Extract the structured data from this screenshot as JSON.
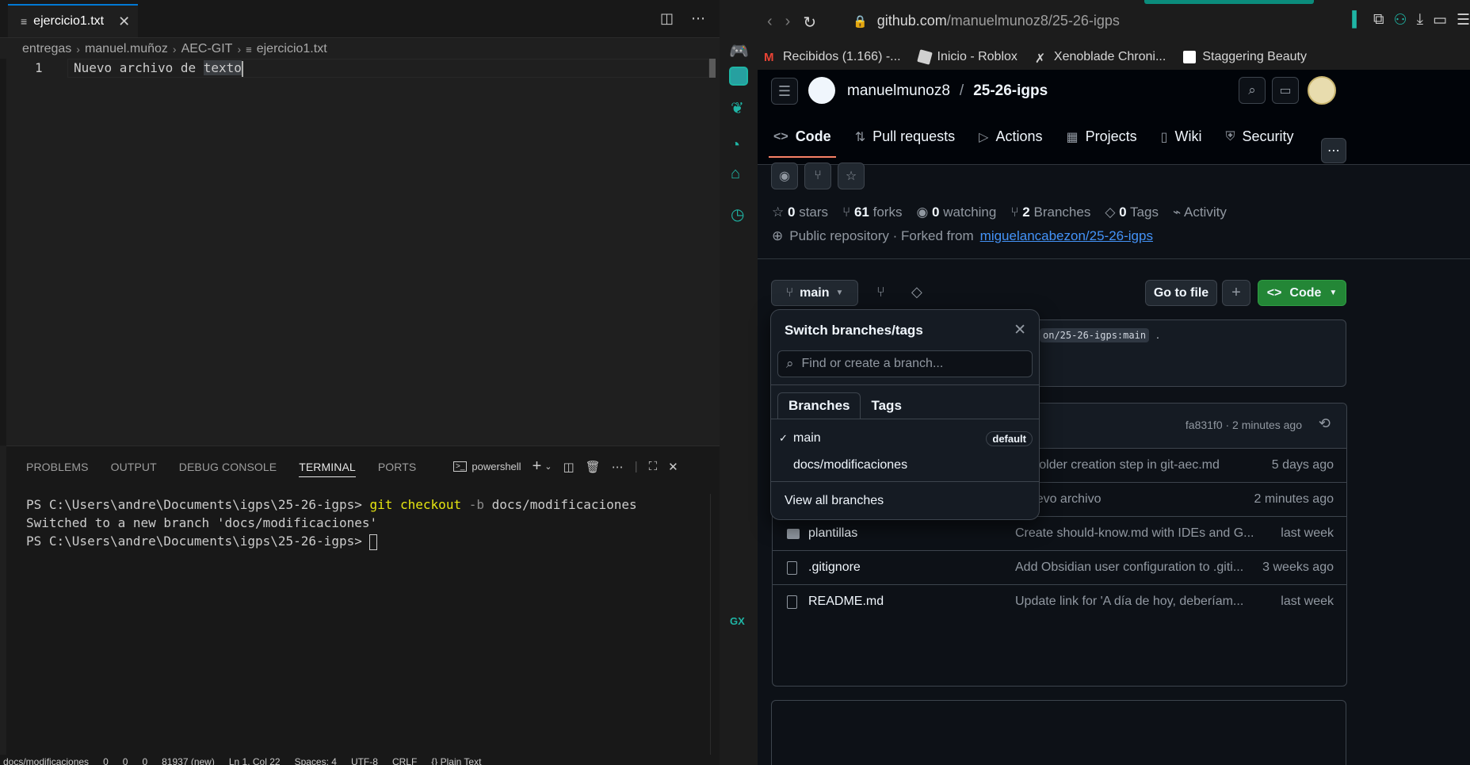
{
  "vscode": {
    "tab_name": "ejercicio1.txt",
    "breadcrumb": [
      "entregas",
      "manuel.muñoz",
      "AEC-GIT",
      "ejercicio1.txt"
    ],
    "editor": {
      "line_number": "1",
      "text_before": "Nuevo archivo de ",
      "text_selected": "texto"
    },
    "panel_tabs": [
      "PROBLEMS",
      "OUTPUT",
      "DEBUG CONSOLE",
      "TERMINAL",
      "PORTS"
    ],
    "active_panel_tab": "TERMINAL",
    "terminal_profile": "powershell",
    "terminal": {
      "prompt": "PS C:\\Users\\andre\\Documents\\igps\\25-26-igps>",
      "cmd_git": "git checkout",
      "cmd_flag": "-b",
      "cmd_arg": "docs/modificaciones",
      "output": "Switched to a new branch 'docs/modificaciones'"
    },
    "status": [
      "docs/modificaciones",
      "0",
      "0",
      "0",
      "81937 (new)",
      "Ln 1, Col 22",
      "Spaces: 4",
      "UTF-8",
      "CRLF",
      "{} Plain Text"
    ]
  },
  "browser": {
    "url_host": "github.com",
    "url_path": "/manuelmunoz8/25-26-igps",
    "favorites": [
      {
        "label": "Recibidos (1.166) -...",
        "color": "#ea4335"
      },
      {
        "label": "Inicio - Roblox",
        "color": "#d0d0d0"
      },
      {
        "label": "Xenoblade Chroni...",
        "color": "#d0d0d0"
      },
      {
        "label": "Staggering Beauty",
        "color": "#ffffff"
      }
    ],
    "bottom_label": "GX"
  },
  "github": {
    "owner": "manuelmunoz8",
    "repo": "25-26-igps",
    "tabs": [
      {
        "label": "Code",
        "icon": "code-icon"
      },
      {
        "label": "Pull requests",
        "icon": "pull-request-icon"
      },
      {
        "label": "Actions",
        "icon": "play-icon"
      },
      {
        "label": "Projects",
        "icon": "table-icon"
      },
      {
        "label": "Wiki",
        "icon": "book-icon"
      },
      {
        "label": "Security",
        "icon": "shield-icon"
      }
    ],
    "stats": {
      "stars_count": "0",
      "stars_label": "stars",
      "forks_count": "61",
      "forks_label": "forks",
      "watching_count": "0",
      "watching_label": "watching",
      "branches_count": "2",
      "branches_label": "Branches",
      "tags_count": "0",
      "tags_label": "Tags",
      "activity_label": "Activity"
    },
    "forked_text": "Public repository · Forked from",
    "forked_link": "miguelancabezon/25-26-igps",
    "branch_button": "main",
    "goto_file": "Go to file",
    "code_button": "Code",
    "compare_snippet": "on/25-26-igps:main",
    "compare_dot": ".",
    "latest_commit": "fa831f0 · 2 minutes ago",
    "files": [
      {
        "name": "",
        "msg": "ect folder creation step in git-aec.md",
        "date": "5 days ago",
        "type": "hidden"
      },
      {
        "name": "",
        "msg": ": nuevo archivo",
        "date": "2 minutes ago",
        "type": "hidden"
      },
      {
        "name": "plantillas",
        "msg": "Create should-know.md with IDEs and G...",
        "date": "last week",
        "type": "folder"
      },
      {
        "name": ".gitignore",
        "msg": "Add Obsidian user configuration to .giti...",
        "date": "3 weeks ago",
        "type": "file"
      },
      {
        "name": "README.md",
        "msg": "Update link for 'A día de hoy, deberíam...",
        "date": "last week",
        "type": "file"
      }
    ],
    "dropdown": {
      "title": "Switch branches/tags",
      "search_placeholder": "Find or create a branch...",
      "tab_branches": "Branches",
      "tab_tags": "Tags",
      "branches": [
        {
          "name": "main",
          "selected": true,
          "badge": "default"
        },
        {
          "name": "docs/modificaciones",
          "selected": false,
          "badge": ""
        }
      ],
      "view_all": "View all branches"
    }
  }
}
